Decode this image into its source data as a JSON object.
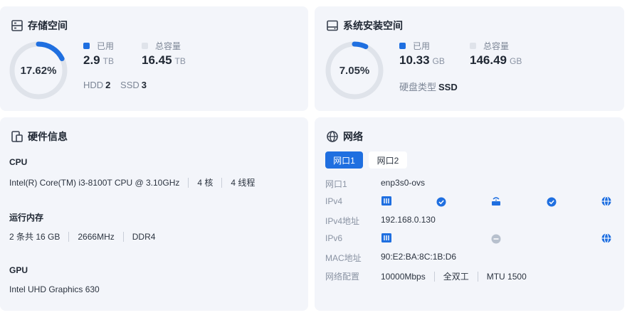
{
  "storage": {
    "title": "存储空间",
    "icon": "storage-icon",
    "percent_label": "17.62%",
    "percent": 0.1762,
    "used_label": "已用",
    "used_value": "2.9",
    "used_unit": "TB",
    "total_label": "总容量",
    "total_value": "16.45",
    "total_unit": "TB",
    "hdd_label": "HDD",
    "hdd_count": "2",
    "ssd_label": "SSD",
    "ssd_count": "3"
  },
  "system_disk": {
    "title": "系统安装空间",
    "icon": "disk-icon",
    "percent_label": "7.05%",
    "percent": 0.0705,
    "used_label": "已用",
    "used_value": "10.33",
    "used_unit": "GB",
    "total_label": "总容量",
    "total_value": "146.49",
    "total_unit": "GB",
    "disk_type_label": "硬盘类型",
    "disk_type": "SSD"
  },
  "hardware": {
    "title": "硬件信息",
    "icon": "hardware-icon",
    "cpu_heading": "CPU",
    "cpu_model": "Intel(R) Core(TM) i3-8100T CPU @ 3.10GHz",
    "cpu_cores": "4 核",
    "cpu_threads": "4 线程",
    "ram_heading": "运行内存",
    "ram_sticks": "2 条共 16 GB",
    "ram_speed": "2666MHz",
    "ram_type": "DDR4",
    "gpu_heading": "GPU",
    "gpu_model": "Intel UHD Graphics 630"
  },
  "network": {
    "title": "网络",
    "icon": "globe-icon",
    "tabs": [
      "网口1",
      "网口2"
    ],
    "active_tab": 0,
    "port_label": "网口1",
    "port_value": "enp3s0-ovs",
    "ipv4_label": "IPv4",
    "ipv4_addr_label": "IPv4地址",
    "ipv4_addr": "192.168.0.130",
    "ipv6_label": "IPv6",
    "mac_label": "MAC地址",
    "mac": "90:E2:BA:8C:1B:D6",
    "config_label": "网络配置",
    "speed": "10000Mbps",
    "duplex": "全双工",
    "mtu": "MTU 1500"
  },
  "colors": {
    "accent": "#1f6fe0",
    "ring_track": "#dfe3ea",
    "card_bg": "#f3f5fa",
    "legend_total": "#dfe3ea",
    "ipv6_inactive": "#b7c0cd"
  }
}
